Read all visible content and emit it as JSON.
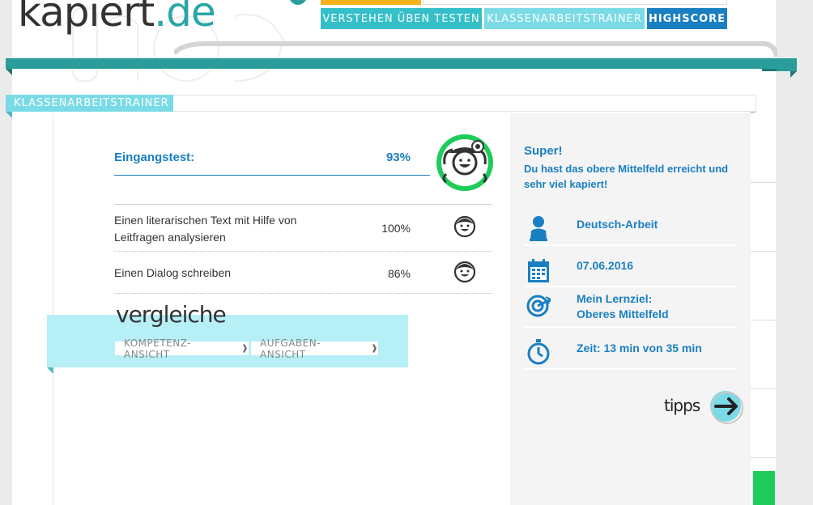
{
  "brand": {
    "logo_text": "kapiert",
    "logo_suffix": ".de"
  },
  "nav": {
    "items": [
      {
        "label": "VERSTEHEN ÜBEN TESTEN"
      },
      {
        "label": "KLASSENARBEITSTRAINER"
      },
      {
        "label": "HIGHSCORE"
      }
    ]
  },
  "section": {
    "label": "KLASSENARBEITSTRAINER"
  },
  "entry_test": {
    "label": "Eingangstest:",
    "score": "93%"
  },
  "results": [
    {
      "label": "Einen literarischen Text mit Hilfe von Leitfragen analysieren",
      "score": "100%"
    },
    {
      "label": "Einen Dialog schreiben",
      "score": "86%"
    }
  ],
  "compare": {
    "heading": "vergleiche",
    "buttons": [
      {
        "label": "KOMPETENZ-ANSICHT"
      },
      {
        "label": "AUFGABEN-ANSICHT"
      }
    ],
    "chevron": "❱"
  },
  "feedback": {
    "title": "Super!",
    "message": "Du hast das obere Mittelfeld erreicht und sehr viel kapiert!"
  },
  "info": {
    "subject": "Deutsch-Arbeit",
    "date": "07.06.2016",
    "goal_label": "Mein Lernziel:",
    "goal_value": "Oberes Mittelfeld",
    "time": "Zeit: 13 min von 35 min"
  },
  "tips": {
    "label": "tipps"
  },
  "colors": {
    "teal": "#2a9d9a",
    "blue": "#1a7fc2",
    "light_cyan": "#b7eff7",
    "nav_cyan": "#35c0c9",
    "green": "#1ecc5a"
  },
  "icons": [
    "person-icon",
    "calendar-icon",
    "target-icon",
    "stopwatch-icon",
    "smiley-face-icon",
    "arrow-right-icon"
  ]
}
